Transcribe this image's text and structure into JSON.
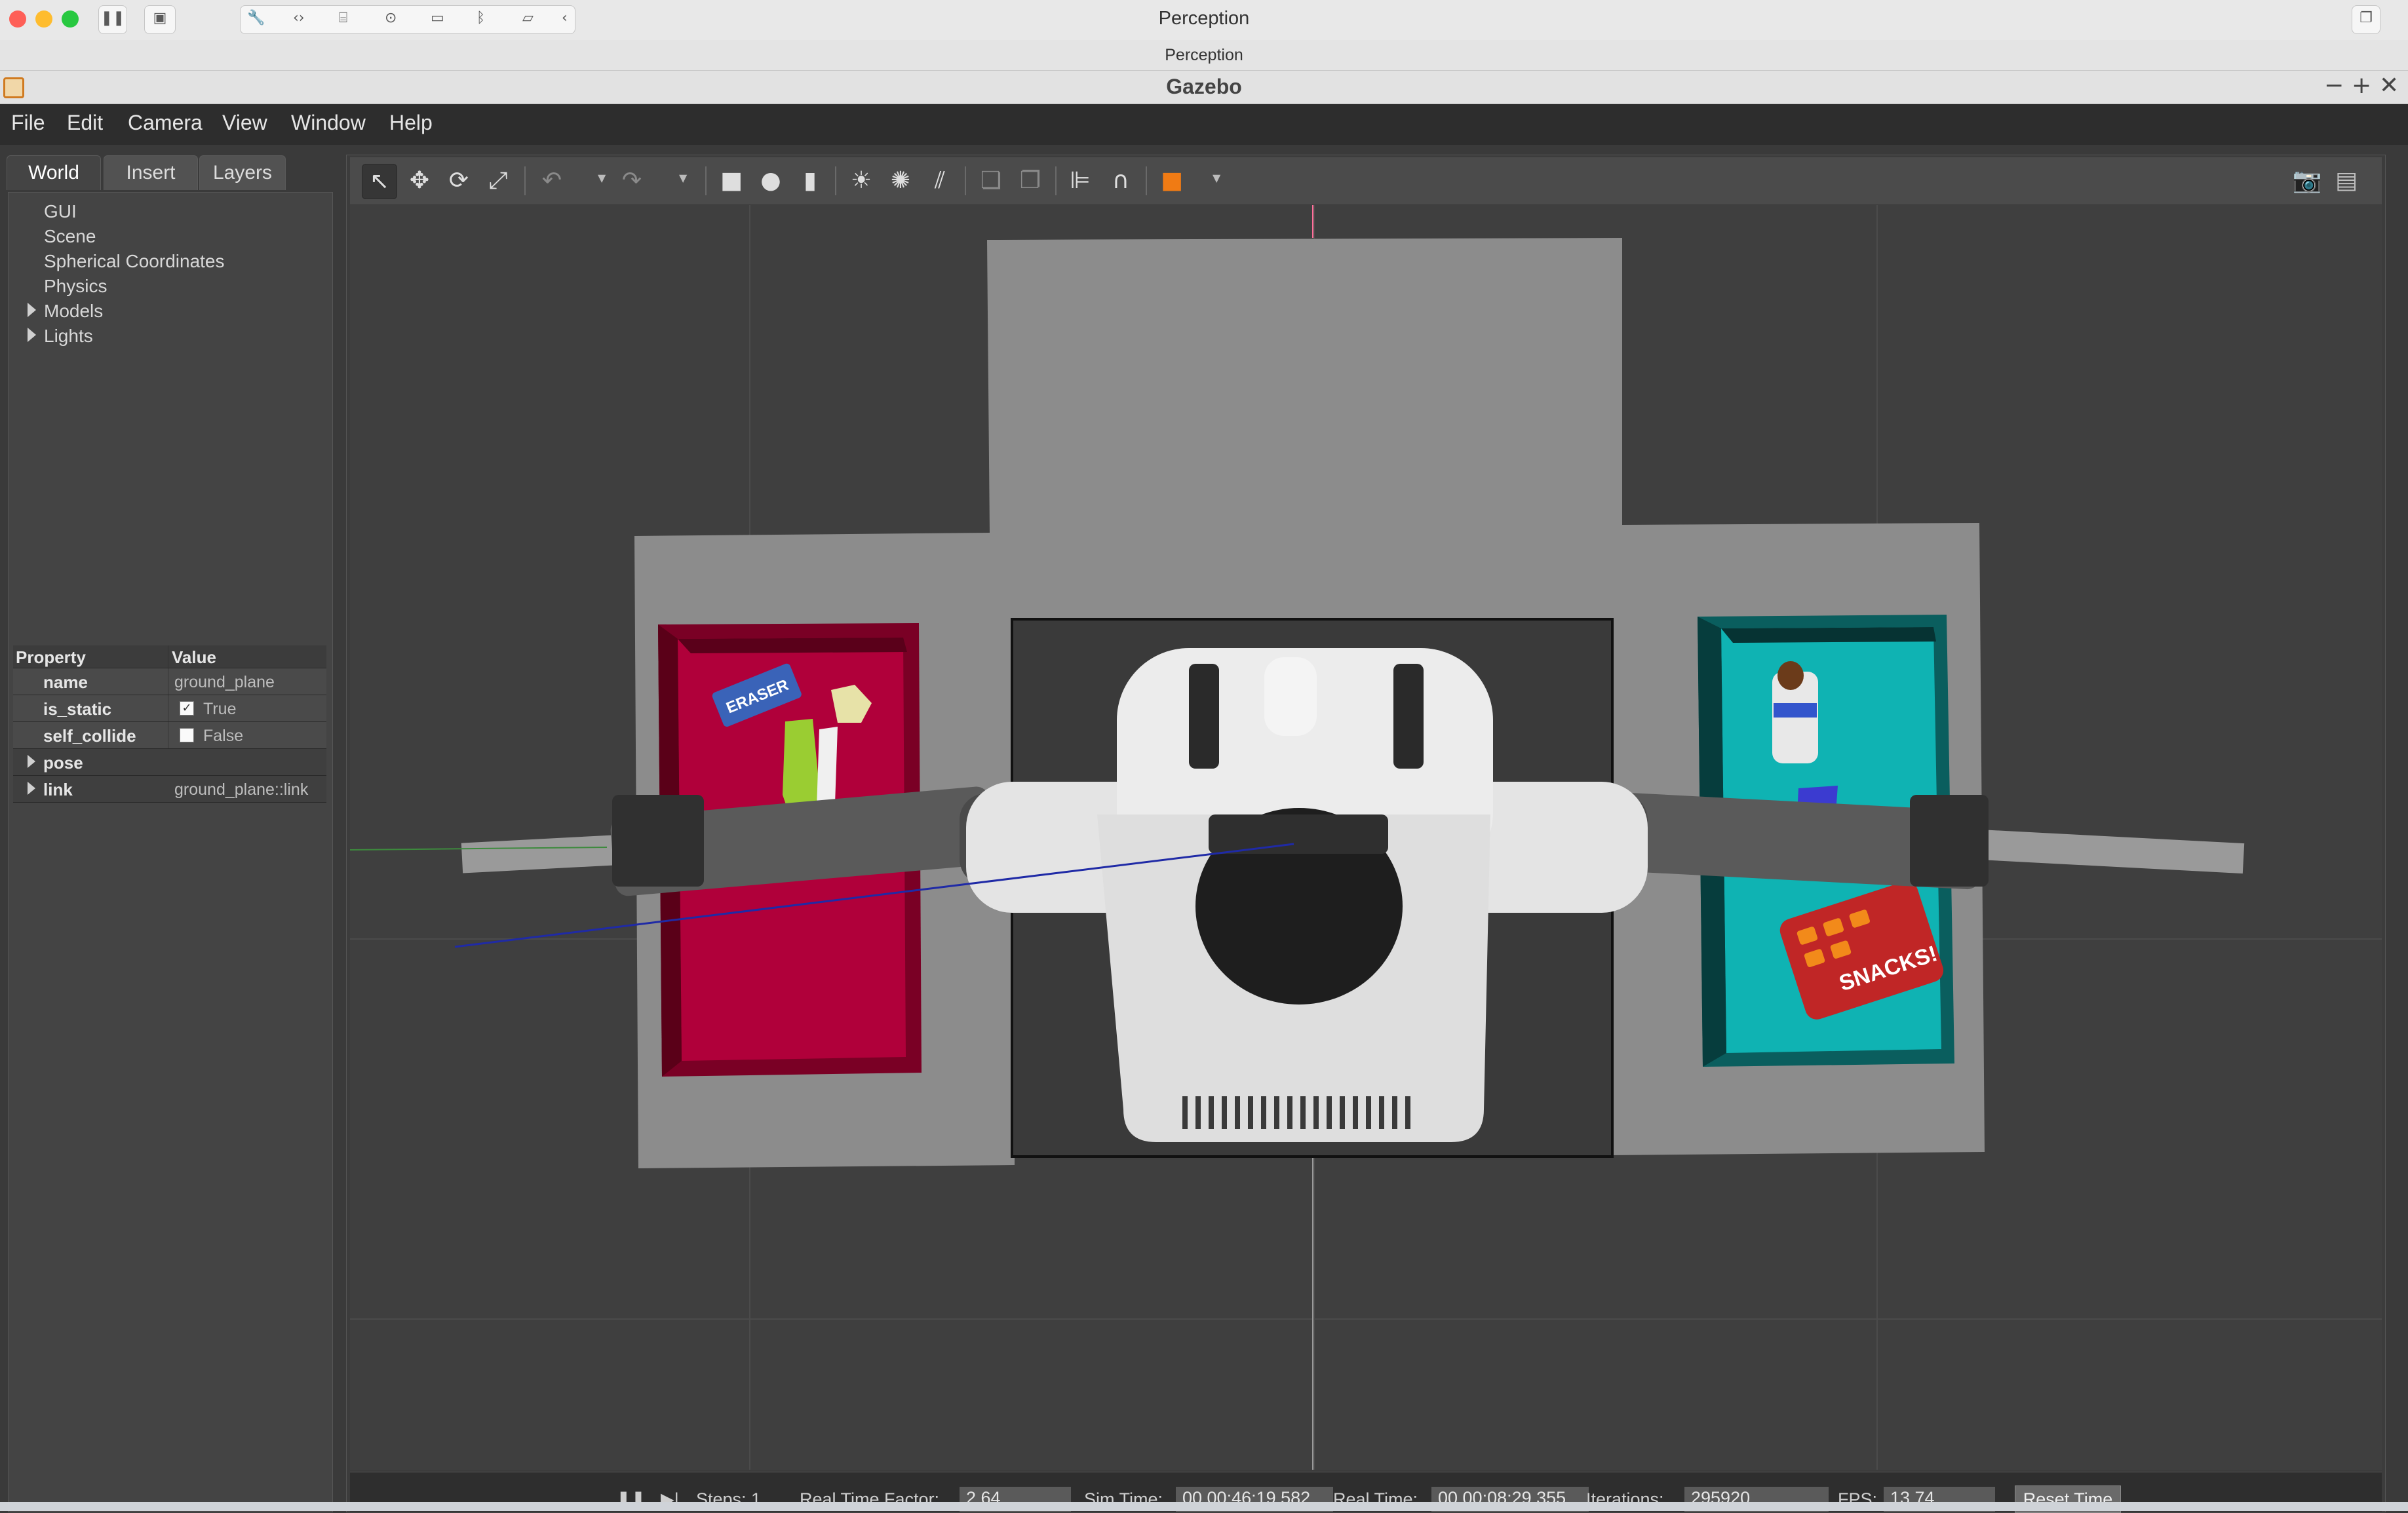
{
  "mac": {
    "title": "Perception",
    "subtitle": "Perception"
  },
  "window": {
    "title": "Gazebo",
    "controls": [
      "−",
      "+",
      "✕"
    ]
  },
  "menu": [
    "File",
    "Edit",
    "Camera",
    "View",
    "Window",
    "Help"
  ],
  "left_panel": {
    "tabs": [
      "World",
      "Insert",
      "Layers"
    ],
    "active_tab": "World",
    "tree": [
      {
        "label": "GUI",
        "expandable": false
      },
      {
        "label": "Scene",
        "expandable": false
      },
      {
        "label": "Spherical Coordinates",
        "expandable": false
      },
      {
        "label": "Physics",
        "expandable": false
      },
      {
        "label": "Models",
        "expandable": true
      },
      {
        "label": "Lights",
        "expandable": true
      }
    ]
  },
  "properties": {
    "header": {
      "property": "Property",
      "value": "Value"
    },
    "rows": {
      "name": {
        "label": "name",
        "value": "ground_plane"
      },
      "is_static": {
        "label": "is_static",
        "value": "True",
        "checked": true
      },
      "self_collide": {
        "label": "self_collide",
        "value": "False",
        "checked": false
      },
      "pose": {
        "label": "pose",
        "value": ""
      },
      "link": {
        "label": "link",
        "value": "ground_plane::link"
      }
    }
  },
  "toolbar": {
    "icons": [
      "select-arrow-icon",
      "translate-icon",
      "rotate-icon",
      "scale-icon",
      "undo-icon",
      "redo-icon",
      "box-icon",
      "sphere-icon",
      "cylinder-icon",
      "point-light-icon",
      "spot-light-icon",
      "directional-light-icon",
      "copy-icon",
      "paste-icon",
      "align-icon",
      "snap-icon",
      "color-shape-icon",
      "screenshot-icon",
      "log-icon"
    ]
  },
  "scene": {
    "labels": {
      "eraser": "ERASER",
      "snacks": "SNACKS!"
    },
    "colors": {
      "background": "#3f3f3f",
      "red_bin": "#b0003a",
      "cyan_bin": "#0fb3b3",
      "table": "#888888",
      "robot": "#d9d9d9"
    }
  },
  "status": {
    "steps_label": "Steps:",
    "steps_value": "1",
    "rtf_label": "Real Time Factor:",
    "rtf_value": "2.64",
    "sim_label": "Sim Time:",
    "sim_value": "00 00:46:19.582",
    "real_label": "Real Time:",
    "real_value": "00 00:08:29.355",
    "iter_label": "Iterations:",
    "iter_value": "295920",
    "fps_label": "FPS:",
    "fps_value": "13.74",
    "reset_label": "Reset Time"
  }
}
